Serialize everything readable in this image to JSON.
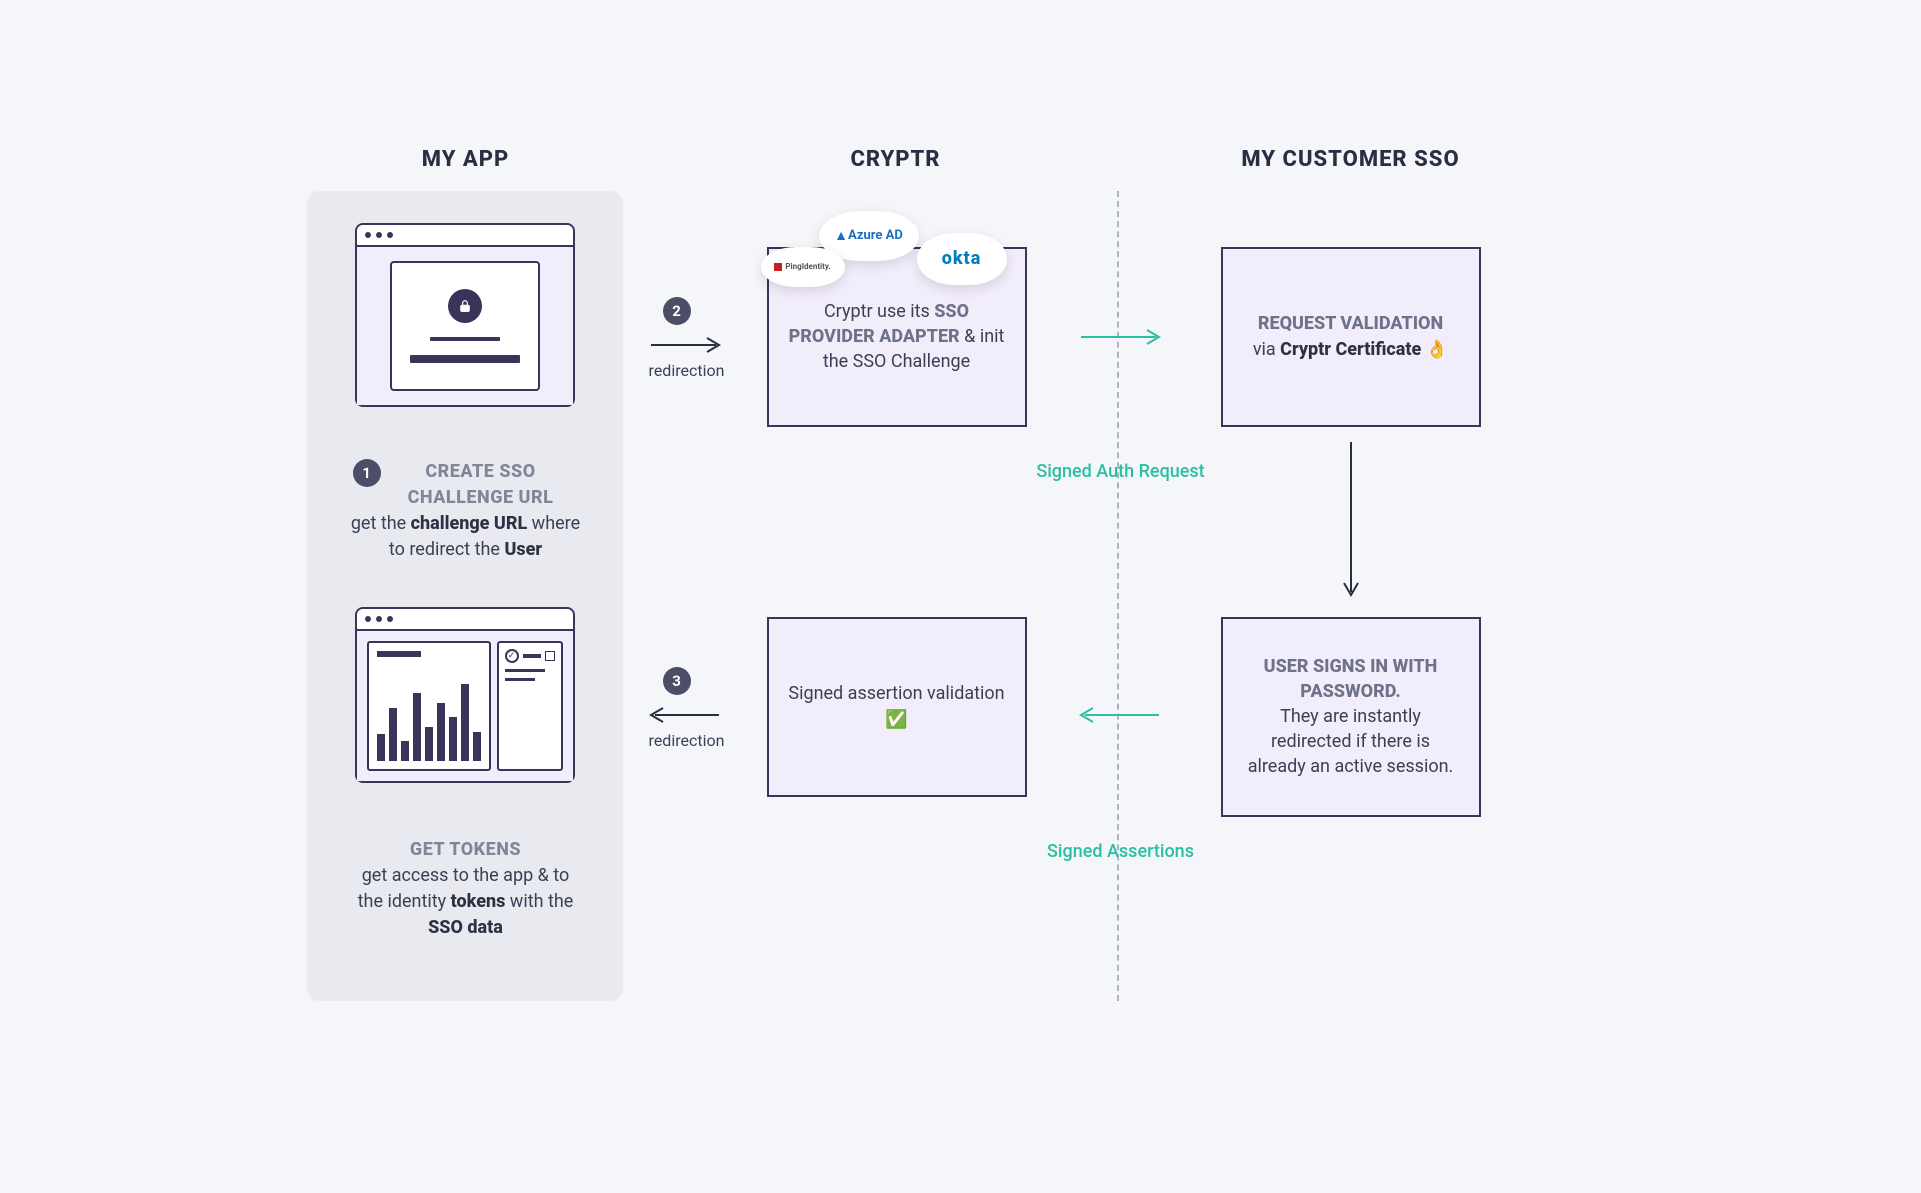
{
  "columns": {
    "my_app": "MY APP",
    "cryptr": "CRYPTR",
    "customer_sso": "MY CUSTOMER SSO"
  },
  "steps": {
    "one": {
      "num": "1",
      "title": "CREATE  SSO CHALLENGE URL",
      "body_pre": "get the ",
      "bold1": "challenge URL",
      "body_mid": " where to redirect the ",
      "bold2": "User"
    },
    "two": {
      "num": "2",
      "label": "redirection"
    },
    "three": {
      "num": "3",
      "label": "redirection"
    },
    "get_tokens": {
      "title": "GET TOKENS",
      "body_pre": "get access to the app & to the identity ",
      "bold1": "tokens",
      "body_mid": " with the ",
      "bold2": "SSO data"
    }
  },
  "cryptr_box_top": {
    "pre": "Cryptr use its ",
    "bold": "SSO PROVIDER ADAPTER",
    "post": " & init the SSO Challenge"
  },
  "cryptr_box_bottom": "Signed assertion validation ✅",
  "sso_box_top": {
    "title": "REQUEST VALIDATION",
    "pre": "via ",
    "bold": "Cryptr Certificate",
    "emoji": " 👌"
  },
  "sso_box_bottom": {
    "title": "USER SIGNS IN WITH PASSWORD.",
    "body": "They are instantly redirected if there is already an active session."
  },
  "teal_labels": {
    "auth_request": "Signed Auth Request",
    "assertions": "Signed Assertions"
  },
  "providers": {
    "azure": "Azure AD",
    "ping": "PingIdentity.",
    "okta": "okta"
  }
}
